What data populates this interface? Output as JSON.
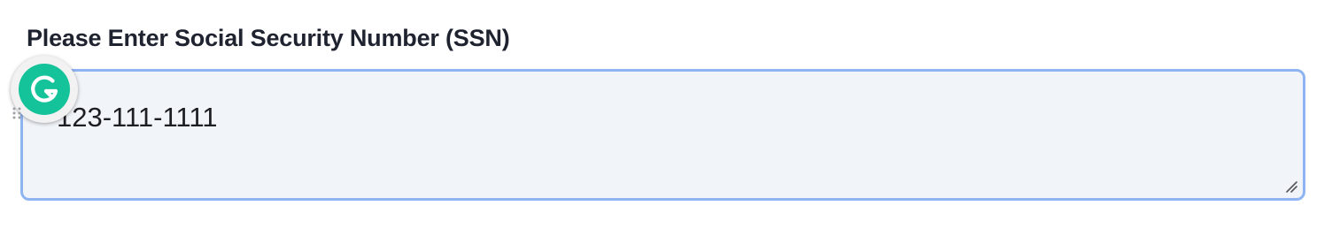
{
  "form": {
    "ssn_label": "Please Enter Social Security Number (SSN)",
    "ssn_value": "123-111-1111"
  },
  "colors": {
    "label_text": "#1f2330",
    "input_border_focus": "#8fb4f2",
    "input_background": "#f1f4f9",
    "grammarly_green": "#15c39a"
  },
  "icons": {
    "grammarly": "grammarly-g-icon",
    "drag": "drag-handle-icon",
    "resize": "resize-grip-icon"
  }
}
